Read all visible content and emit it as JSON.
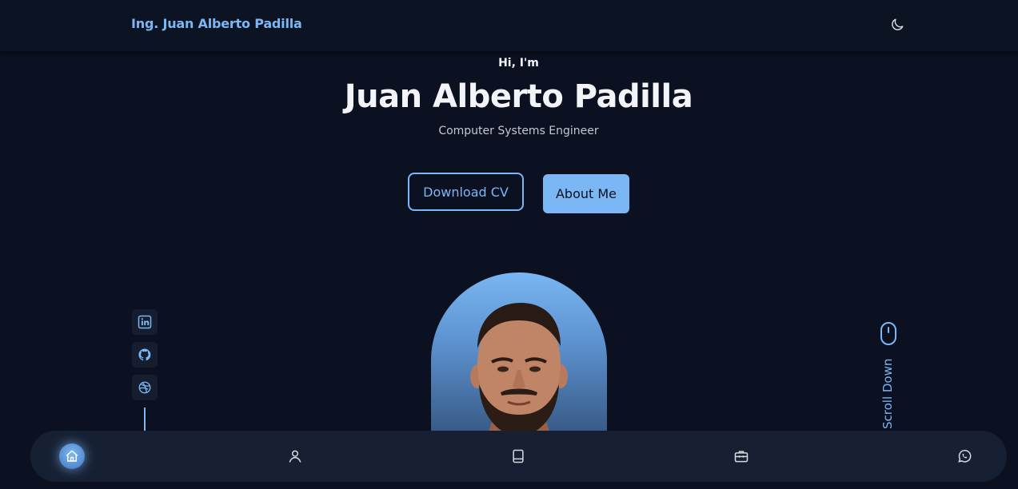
{
  "header": {
    "brand": "Ing. Juan Alberto Padilla",
    "theme_icon": "moon-icon"
  },
  "hero": {
    "greeting": "Hi, I'm",
    "name": "Juan Alberto Padilla",
    "role": "Computer Systems Engineer",
    "buttons": {
      "download_cv": "Download CV",
      "about_me": "About Me"
    },
    "portrait_alt": "Portrait of Juan Alberto Padilla"
  },
  "socials": [
    {
      "icon": "linkedin-icon"
    },
    {
      "icon": "github-icon"
    },
    {
      "icon": "dribbble-icon"
    }
  ],
  "scroll": {
    "label": "Scroll Down",
    "icon": "mouse-icon"
  },
  "bottom_nav": {
    "items": [
      {
        "icon": "home-icon",
        "active": true
      },
      {
        "icon": "user-icon",
        "active": false
      },
      {
        "icon": "book-icon",
        "active": false
      },
      {
        "icon": "briefcase-icon",
        "active": false
      },
      {
        "icon": "whatsapp-icon",
        "active": false
      }
    ]
  },
  "colors": {
    "background": "#0b1120",
    "accent": "#7cb7f5",
    "nav_background": "#172033",
    "text": "#f3f4f7"
  }
}
